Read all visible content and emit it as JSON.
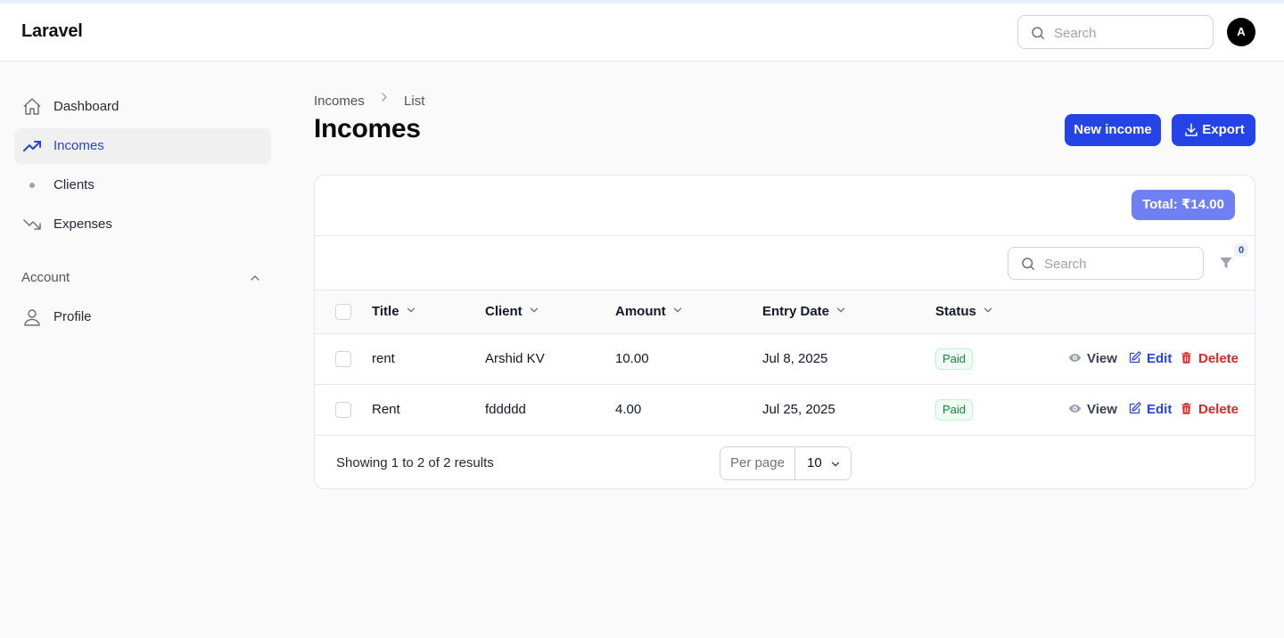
{
  "app": {
    "brand": "Laravel"
  },
  "topbar": {
    "search_placeholder": "Search",
    "avatar_initial": "A"
  },
  "sidebar": {
    "items": [
      {
        "label": "Dashboard",
        "icon": "home-icon"
      },
      {
        "label": "Incomes",
        "icon": "trending-up-icon",
        "active": true
      },
      {
        "label": "Clients",
        "icon": "dot-icon"
      },
      {
        "label": "Expenses",
        "icon": "trending-down-icon"
      }
    ],
    "account_group": {
      "label": "Account",
      "items": [
        {
          "label": "Profile",
          "icon": "user-icon"
        }
      ]
    }
  },
  "breadcrumb": {
    "items": [
      "Incomes",
      "List"
    ]
  },
  "page": {
    "title": "Incomes",
    "new_button": "New income",
    "export_button": "Export"
  },
  "summary": {
    "total": "Total: ₹14.00"
  },
  "table": {
    "search_placeholder": "Search",
    "filter_count": "0",
    "columns": [
      "Title",
      "Client",
      "Amount",
      "Entry Date",
      "Status"
    ],
    "rows": [
      {
        "title": "rent",
        "client": "Arshid KV",
        "amount": "10.00",
        "entry_date": "Jul 8, 2025",
        "status": "Paid"
      },
      {
        "title": "Rent",
        "client": "fddddd",
        "amount": "4.00",
        "entry_date": "Jul 25, 2025",
        "status": "Paid"
      }
    ],
    "actions": {
      "view": "View",
      "edit": "Edit",
      "delete": "Delete"
    }
  },
  "pagination": {
    "summary": "Showing 1 to 2 of 2 results",
    "per_page_label": "Per page",
    "per_page_value": "10"
  },
  "colors": {
    "primary": "#2544e8",
    "total_badge": "#6f80f2",
    "paid_text": "#15803d",
    "delete": "#dc2626"
  }
}
